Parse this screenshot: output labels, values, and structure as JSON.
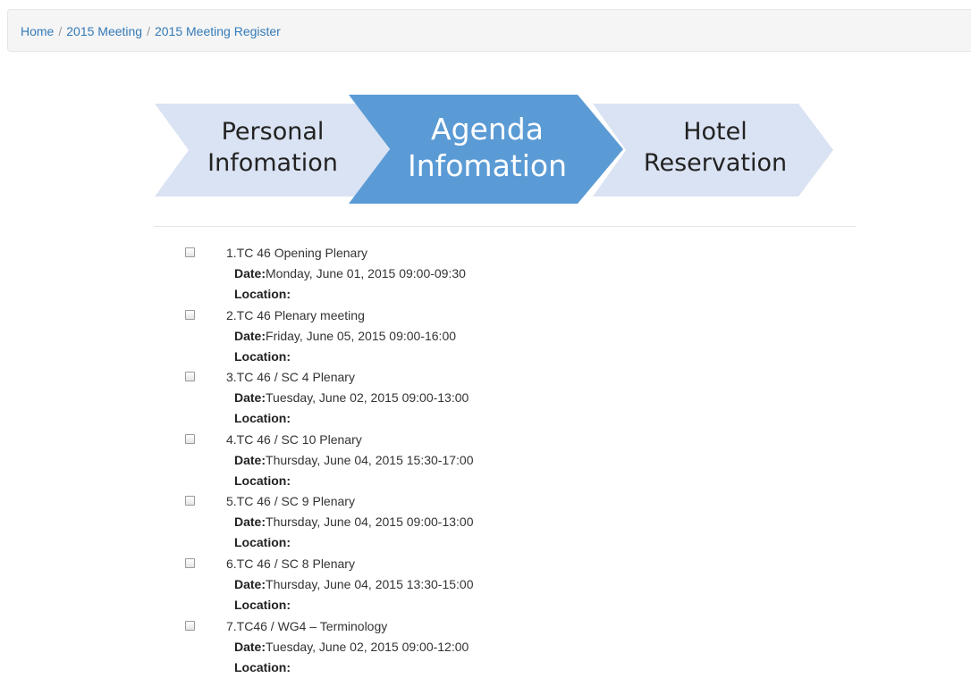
{
  "breadcrumb": {
    "home": "Home",
    "meeting": "2015 Meeting",
    "register": "2015 Meeting Register",
    "separator": "/"
  },
  "steps": [
    {
      "line1": "Personal",
      "line2": "Infomation",
      "state": "inactive"
    },
    {
      "line1": "Agenda",
      "line2": "Infomation",
      "state": "active"
    },
    {
      "line1": "Hotel",
      "line2": "Reservation",
      "state": "inactive"
    }
  ],
  "colors": {
    "step_active": "#5b9bd5",
    "step_inactive": "#dae3f3",
    "link": "#337ab7",
    "breadcrumb_bg": "#f5f5f5"
  },
  "labels": {
    "date": "Date:",
    "location": "Location:"
  },
  "agenda": [
    {
      "title": "1.TC 46 Opening Plenary",
      "date": "Monday, June 01, 2015 09:00-09:30",
      "location": "",
      "checked": false
    },
    {
      "title": "2.TC 46 Plenary meeting",
      "date": "Friday, June 05, 2015 09:00-16:00",
      "location": "",
      "checked": false
    },
    {
      "title": "3.TC 46 / SC 4 Plenary",
      "date": "Tuesday, June 02, 2015 09:00-13:00",
      "location": "",
      "checked": false
    },
    {
      "title": "4.TC 46 / SC 10 Plenary",
      "date": "Thursday, June 04, 2015 15:30-17:00",
      "location": "",
      "checked": false
    },
    {
      "title": "5.TC 46 / SC 9 Plenary",
      "date": "Thursday, June 04, 2015 09:00-13:00",
      "location": "",
      "checked": false
    },
    {
      "title": "6.TC 46 / SC 8 Plenary",
      "date": "Thursday, June 04, 2015 13:30-15:00",
      "location": "",
      "checked": false
    },
    {
      "title": "7.TC46 / WG4 – Terminology",
      "date": "Tuesday, June 02, 2015 09:00-12:00",
      "location": "",
      "checked": false
    }
  ]
}
